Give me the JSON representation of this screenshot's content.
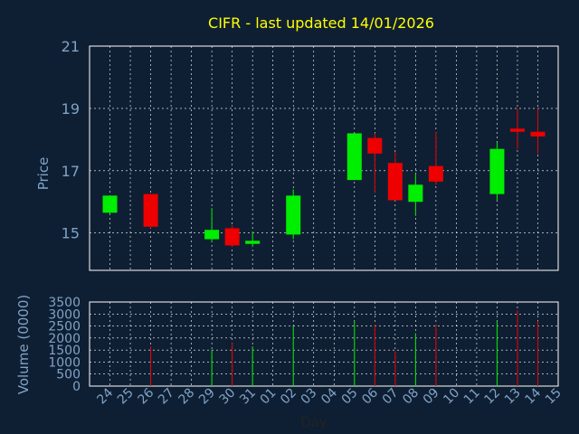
{
  "chart_data": {
    "type": "candlestick",
    "title": "CIFR - last updated 14/01/2026",
    "xlabel": "Day",
    "price_ylabel": "Price",
    "volume_ylabel": "Volume (0000)",
    "x_ticks": [
      "24",
      "25",
      "26",
      "27",
      "28",
      "29",
      "30",
      "31",
      "01",
      "02",
      "03",
      "04",
      "05",
      "06",
      "07",
      "08",
      "09",
      "10",
      "11",
      "12",
      "13",
      "14",
      "15"
    ],
    "price_ylim": [
      13.8,
      21
    ],
    "price_ticks": [
      15,
      17,
      19,
      21
    ],
    "volume_ylim": [
      0,
      3500
    ],
    "volume_ticks": [
      0,
      500,
      1000,
      1500,
      2000,
      2500,
      3000,
      3500
    ],
    "grid": true,
    "colors": {
      "up": "#00ee00",
      "down": "#ee0000",
      "background": "#0f1f33",
      "text": "#7fa3c6",
      "title": "#ffff00",
      "grid": "#ffffff"
    },
    "candles": [
      {
        "day": "24",
        "open": 15.65,
        "high": 16.2,
        "low": 15.6,
        "close": 16.2,
        "volume": 0
      },
      {
        "day": "26",
        "open": 16.25,
        "high": 16.25,
        "low": 15.15,
        "close": 15.2,
        "volume": 1650
      },
      {
        "day": "29",
        "open": 14.8,
        "high": 15.8,
        "low": 14.7,
        "close": 15.1,
        "volume": 1500
      },
      {
        "day": "30",
        "open": 15.15,
        "high": 15.25,
        "low": 14.55,
        "close": 14.6,
        "volume": 1800
      },
      {
        "day": "31",
        "open": 14.65,
        "high": 15.05,
        "low": 14.55,
        "close": 14.75,
        "volume": 1650
      },
      {
        "day": "02",
        "open": 14.95,
        "high": 16.4,
        "low": 14.8,
        "close": 16.2,
        "volume": 2500
      },
      {
        "day": "05",
        "open": 16.7,
        "high": 18.2,
        "low": 16.7,
        "close": 18.2,
        "volume": 2700
      },
      {
        "day": "06",
        "open": 18.05,
        "high": 18.2,
        "low": 16.3,
        "close": 17.55,
        "volume": 2550
      },
      {
        "day": "07",
        "open": 17.25,
        "high": 17.6,
        "low": 16.05,
        "close": 16.05,
        "volume": 1450
      },
      {
        "day": "08",
        "open": 16.0,
        "high": 16.9,
        "low": 15.55,
        "close": 16.55,
        "volume": 2200
      },
      {
        "day": "09",
        "open": 17.15,
        "high": 18.25,
        "low": 16.55,
        "close": 16.65,
        "volume": 2550
      },
      {
        "day": "12",
        "open": 16.25,
        "high": 17.9,
        "low": 16.05,
        "close": 17.7,
        "volume": 2700
      },
      {
        "day": "13",
        "open": 18.35,
        "high": 19.0,
        "low": 17.7,
        "close": 18.25,
        "volume": 3150
      },
      {
        "day": "14",
        "open": 18.25,
        "high": 19.0,
        "low": 17.55,
        "close": 18.1,
        "volume": 2700
      }
    ]
  }
}
